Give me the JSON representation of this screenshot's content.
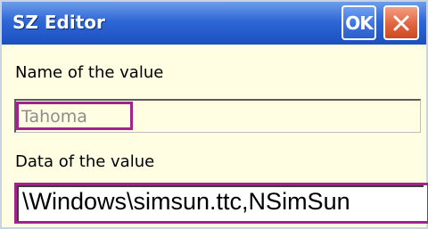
{
  "window": {
    "title": "SZ Editor",
    "ok_label": "OK"
  },
  "form": {
    "name_label": "Name of the value",
    "name_value": "Tahoma",
    "data_label": "Data of the value",
    "data_value": "\\Windows\\simsun.ttc,NSimSun"
  },
  "icons": {
    "close": "close-icon"
  },
  "colors": {
    "titlebar": "#2f67d6",
    "highlight": "#a3238d",
    "background": "#fffde2",
    "close_button": "#e1643f"
  }
}
